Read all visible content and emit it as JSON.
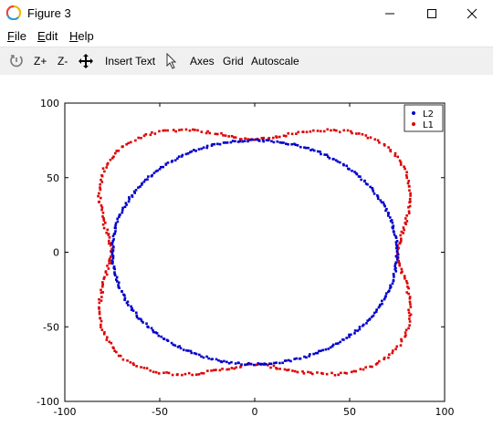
{
  "window": {
    "title": "Figure 3",
    "minimize_icon": "minimize-icon",
    "maximize_icon": "maximize-icon",
    "close_icon": "close-icon"
  },
  "menu": {
    "file": {
      "underlined": "F",
      "rest": "ile"
    },
    "edit": {
      "underlined": "E",
      "rest": "dit"
    },
    "help": {
      "underlined": "H",
      "rest": "elp"
    }
  },
  "toolbar": {
    "rotate_icon": "rotate-icon",
    "zoom_in": "Z+",
    "zoom_out": "Z-",
    "pan_icon": "pan-arrows-icon",
    "insert_text": "Insert Text",
    "select_icon": "cursor-arrow-icon",
    "axes": "Axes",
    "grid": "Grid",
    "autoscale": "Autoscale"
  },
  "chart_data": {
    "type": "scatter",
    "title": "",
    "xlabel": "",
    "ylabel": "",
    "xlim": [
      -100,
      100
    ],
    "ylim": [
      -100,
      100
    ],
    "xticks": [
      -100,
      -50,
      0,
      50,
      100
    ],
    "yticks": [
      -100,
      -50,
      0,
      50,
      100
    ],
    "grid": false,
    "legend_position": "top-right",
    "series": [
      {
        "name": "L2",
        "color": "#0000cc",
        "marker": "dot",
        "shape": "circle",
        "radius": 75,
        "points": 360
      },
      {
        "name": "L1",
        "color": "#dd0000",
        "marker": "dot",
        "shape": "four-lobe curve",
        "points": 360,
        "key_values": {
          "max_abs_x": 92,
          "max_abs_y": 92,
          "axis_crossings": 75
        }
      }
    ]
  }
}
